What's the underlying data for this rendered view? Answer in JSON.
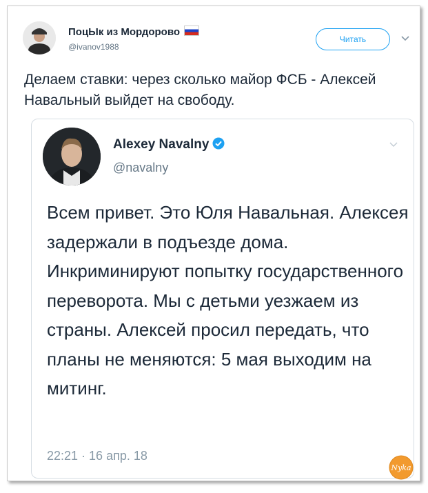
{
  "tweet": {
    "author_name": "ПоцЫк из Мордорово",
    "author_handle": "@ivanov1988",
    "follow_label": "Читать",
    "text": "Делаем ставки: через сколько майор ФСБ - Алексей Навальный выйдет на свободу.",
    "flag_icon": "russia-flag-icon",
    "chevron_icon": "chevron-down-icon"
  },
  "quoted_tweet": {
    "author_name": "Alexey Navalny",
    "author_handle": "@navalny",
    "verified_icon": "verified-badge-icon",
    "text": "Всем привет. Это Юля Навальная. Алексея задержали в подъезде дома. Инкриминируют попытку государственного переворота. Мы с детьми уезжаем из страны. Алексей просил передать, что планы не меняются: 5 мая выходим на митинг.",
    "timestamp": "22:21 · 16 апр. 18"
  },
  "watermark": {
    "text": "Nyka",
    "colors": {
      "bg": "#f29a2e",
      "fg": "#ffffff"
    }
  },
  "colors": {
    "accent": "#1da1f2",
    "text": "#1c2938",
    "muted": "#657786"
  }
}
